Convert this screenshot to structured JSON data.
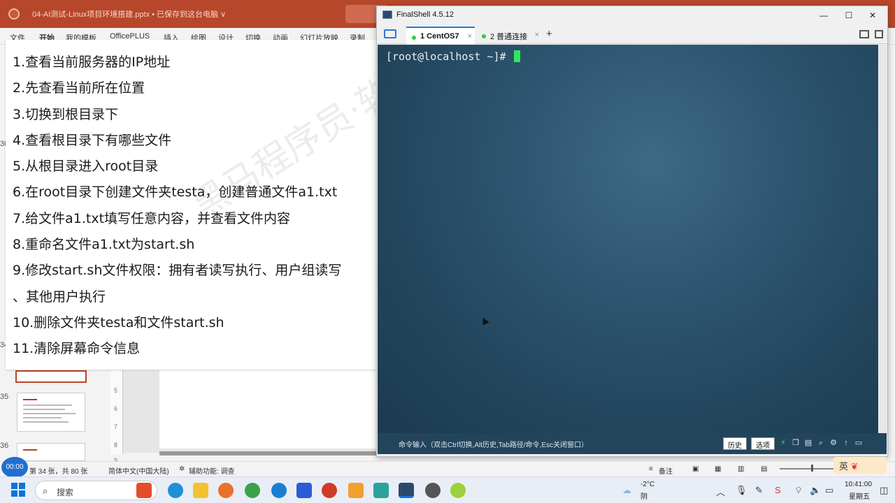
{
  "ppt": {
    "doc_title": "04-AI测试-Linux项目环境搭建.pptx • 已保存到这台电脑 ∨",
    "ribbon_tabs": [
      "文件",
      "开始",
      "我的模板",
      "OfficePLUS",
      "插入",
      "绘图",
      "设计",
      "切换",
      "动画",
      "幻灯片放映",
      "录制"
    ],
    "slide_numbers": [
      "30",
      "34",
      "35",
      "36"
    ],
    "ruler_marks": [
      "5",
      "6",
      "7",
      "8",
      "9"
    ],
    "status": {
      "recording_time": "00:00",
      "slide_info": "第 34 张，共 80 张",
      "language": "简体中文(中国大陆)",
      "accessibility": "辅助功能: 调查",
      "notes": "备注",
      "ime": "英"
    }
  },
  "task_panel": {
    "watermark": "黑马程序员·软件",
    "items": [
      "1.查看当前服务器的IP地址",
      "2.先查看当前所在位置",
      "3.切换到根目录下",
      "4.查看根目录下有哪些文件",
      "5.从根目录进入root目录",
      "6.在root目录下创建文件夹testa，创建普通文件a1.txt",
      "7.给文件a1.txt填写任意内容，并查看文件内容",
      "8.重命名文件a1.txt为start.sh",
      "9.修改start.sh文件权限：拥有者读写执行、用户组读写",
      "、其他用户执行",
      "10.删除文件夹testa和文件start.sh",
      "11.清除屏幕命令信息"
    ]
  },
  "finalshell": {
    "title": "FinalShell 4.5.12",
    "window_buttons": [
      "—",
      "☐",
      "✕"
    ],
    "tabs": [
      {
        "label": "1 CentOS7",
        "close": "×"
      },
      {
        "label": "2 普通连接",
        "close": "×"
      }
    ],
    "add_tab": "+",
    "prompt": "[root@localhost ~]#",
    "cmd_hint": "命令输入（双击Ctrl切换,Alt历史,Tab路径/命令,Esc关闭窗口）",
    "history_button": "历史",
    "options_button": "选项"
  },
  "taskbar": {
    "search_placeholder": "搜索",
    "weather_temp": "-2°C",
    "weather_desc": "阴",
    "time": "10:41:00",
    "weekday": "星期五"
  }
}
